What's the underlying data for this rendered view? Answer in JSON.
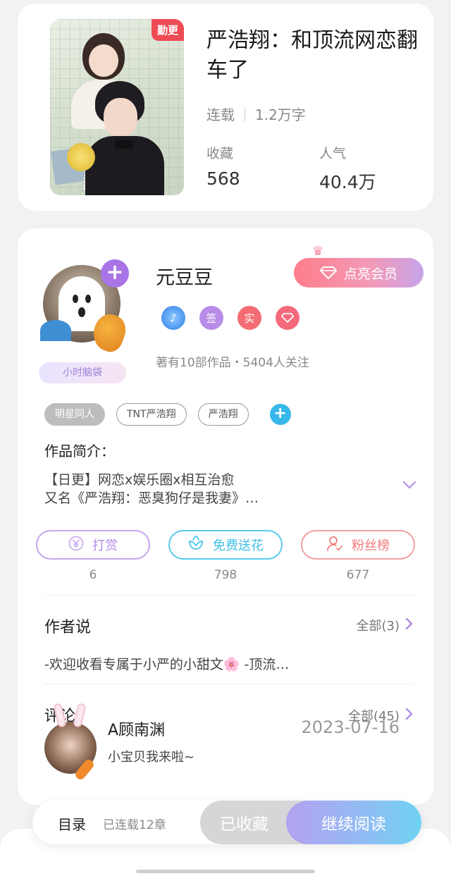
{
  "book": {
    "cover_badge": "勤更",
    "title": "严浩翔：和顶流网恋翻车了",
    "status": "连载",
    "word_count": "1.2万字",
    "stats": [
      {
        "label": "收藏",
        "value": "568"
      },
      {
        "label": "人气",
        "value": "40.4万"
      }
    ]
  },
  "author": {
    "name": "元豆豆",
    "follow_icon": "plus-icon",
    "avatar_tag": "小时脑袋",
    "vip_button": "点亮会员",
    "badges": [
      {
        "icon": "music-note-icon",
        "text": "",
        "color": "#3f8ef0"
      },
      {
        "icon": "sign-badge",
        "text": "签",
        "color": "#b88ce8"
      },
      {
        "icon": "verified-badge",
        "text": "实",
        "color": "#f36b73"
      },
      {
        "icon": "diamond-badge",
        "text": "",
        "color": "#f46a7c"
      }
    ],
    "stats_line": "著有10部作品・5404人关注"
  },
  "tags": [
    "明星同人",
    "TNT严浩翔",
    "严浩翔"
  ],
  "intro": {
    "label": "作品简介：",
    "line1": "【日更】网恋x娱乐圈x相互治愈",
    "line2": "又名《严浩翔：恶臭狗仔是我妻》…"
  },
  "actions": [
    {
      "label": "打赏",
      "count": "6",
      "icon": "yen-icon",
      "color": "#b68de6"
    },
    {
      "label": "免费送花",
      "count": "798",
      "icon": "flower-icon",
      "color": "#3fc0e8"
    },
    {
      "label": "粉丝榜",
      "count": "677",
      "icon": "user-rank-icon",
      "color": "#f07a7a"
    }
  ],
  "author_says": {
    "title": "作者说",
    "all_label": "全部(3)",
    "text": "-欢迎收看专属于小严的小甜文🌸 -顶流…"
  },
  "comments": {
    "title": "评论",
    "all_label": "全部(45)",
    "items": [
      {
        "user": "A顾南渊",
        "date": "2023-07-16",
        "text": "小宝贝我来啦~"
      }
    ]
  },
  "bottom_bar": {
    "toc_label": "目录",
    "toc_status": "已连载12章",
    "favorite_label": "已收藏",
    "read_label": "继续阅读"
  },
  "colors": {
    "accent_purple": "#a974e6",
    "accent_blue": "#37b8ea",
    "badge_red": "#ef4b55"
  }
}
